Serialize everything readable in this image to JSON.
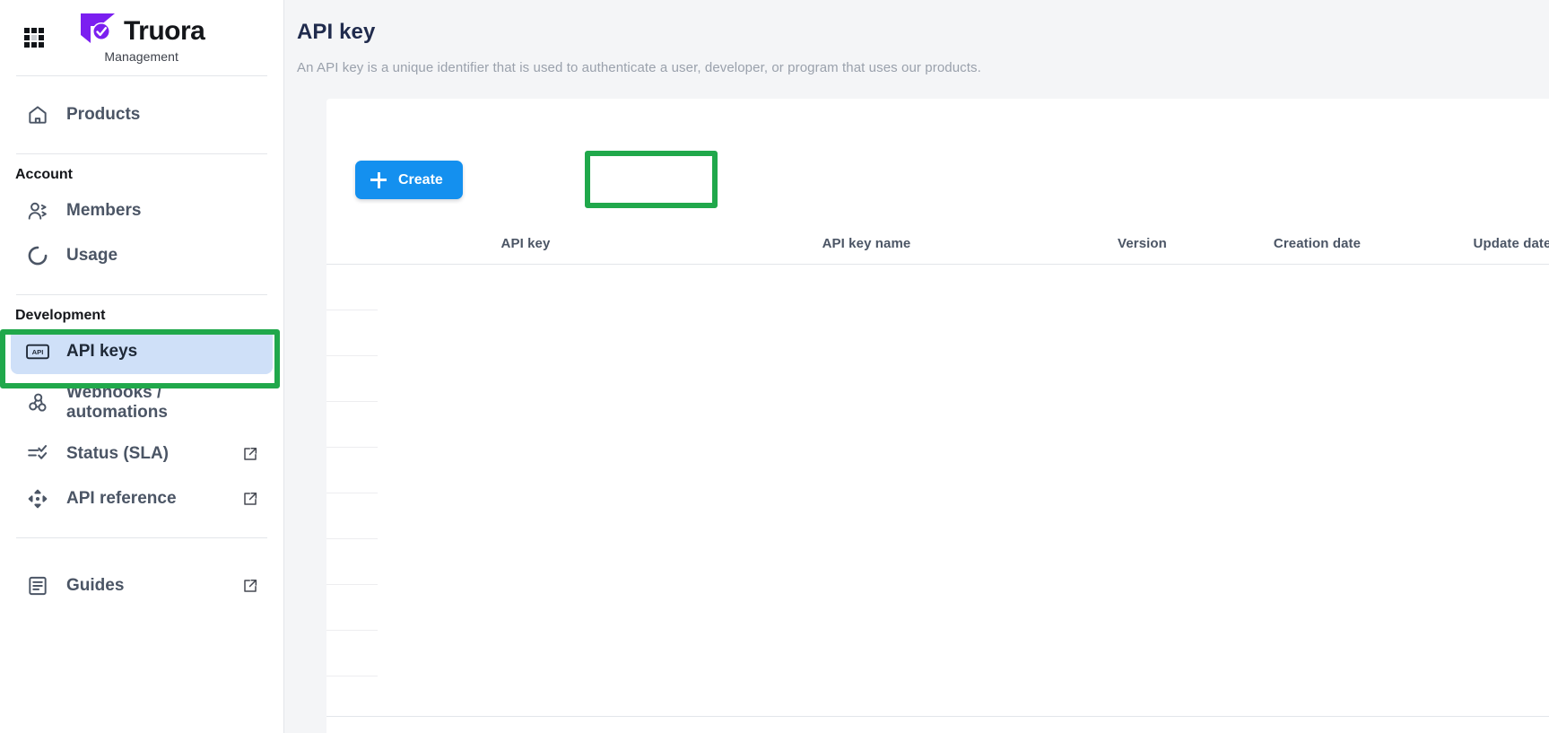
{
  "brand": {
    "name": "Truora",
    "subtitle": "Management",
    "apps_icon": "grid-apps-icon",
    "logo_icon": "truora-check-logo"
  },
  "sidebar": {
    "primary": [
      {
        "label": "Products",
        "icon": "home-icon",
        "external": false,
        "active": false
      }
    ],
    "groups": [
      {
        "label": "Account",
        "items": [
          {
            "label": "Members",
            "icon": "users-icon",
            "external": false,
            "active": false
          },
          {
            "label": "Usage",
            "icon": "usage-donut-icon",
            "external": false,
            "active": false
          }
        ]
      },
      {
        "label": "Development",
        "items": [
          {
            "label": "API keys",
            "icon": "api-badge-icon",
            "external": false,
            "active": true
          },
          {
            "label": "Webhooks / automations",
            "icon": "webhook-icon",
            "external": false,
            "active": false
          },
          {
            "label": "Status (SLA)",
            "icon": "checklist-icon",
            "external": true,
            "active": false
          },
          {
            "label": "API reference",
            "icon": "move-arrows-icon",
            "external": true,
            "active": false
          }
        ]
      },
      {
        "label": "",
        "items": [
          {
            "label": "Guides",
            "icon": "document-lines-icon",
            "external": true,
            "active": false
          }
        ]
      }
    ]
  },
  "page": {
    "title": "API key",
    "description": "An API key is a unique identifier that is used to authenticate a user, developer, or program that uses our products."
  },
  "toolbar": {
    "create_label": "Create",
    "create_icon": "plus-icon"
  },
  "table": {
    "columns": [
      "API key",
      "API key name",
      "Version",
      "Creation date",
      "Update date"
    ],
    "rows": [],
    "empty_row_count": 9
  },
  "highlights": [
    {
      "name": "sidebar-api-keys-highlight",
      "color": "#20a84b"
    },
    {
      "name": "create-button-highlight",
      "color": "#20a84b"
    }
  ],
  "colors": {
    "accent_blue": "#1490ef",
    "highlight_green": "#20a84b",
    "active_nav_bg": "#cfe0f8",
    "title_navy": "#202b4d",
    "brand_purple": "#7b1ff0"
  }
}
